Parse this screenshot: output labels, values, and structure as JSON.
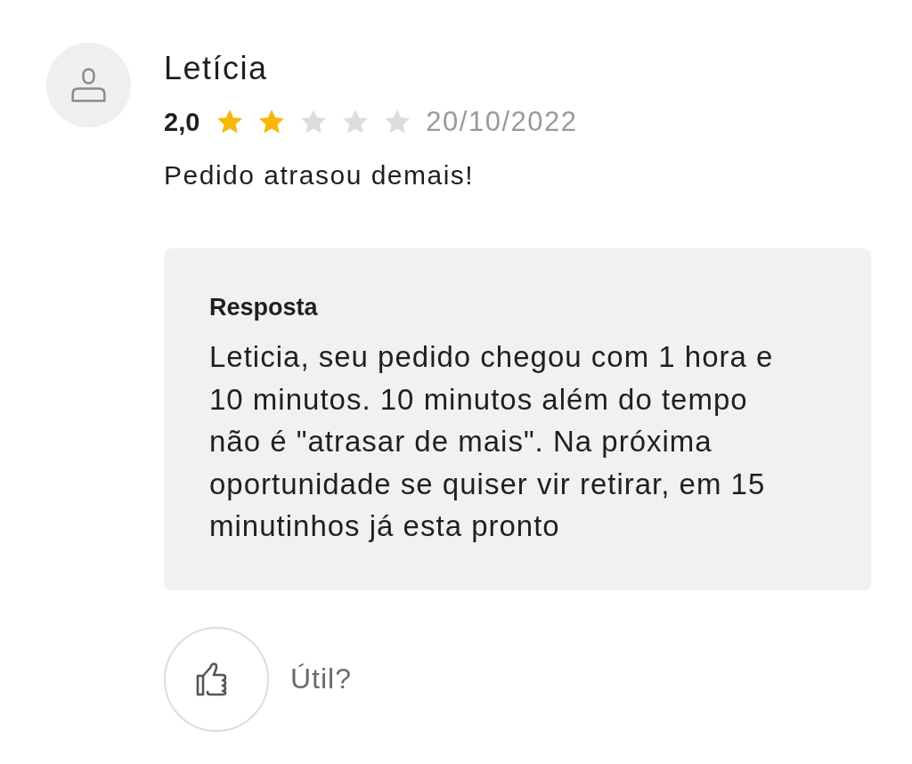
{
  "review": {
    "author": "Letícia",
    "rating": "2,0",
    "stars": 2,
    "date": "20/10/2022",
    "comment": "Pedido atrasou demais!"
  },
  "reply": {
    "title": "Resposta",
    "text": "Leticia, seu pedido chegou com 1 hora e 10 minutos. 10 minutos além do tempo não é \"atrasar de mais\". Na próxima oportunidade se quiser vir retirar, em 15 minutinhos já esta pronto"
  },
  "helpful": {
    "label": "Útil?"
  }
}
